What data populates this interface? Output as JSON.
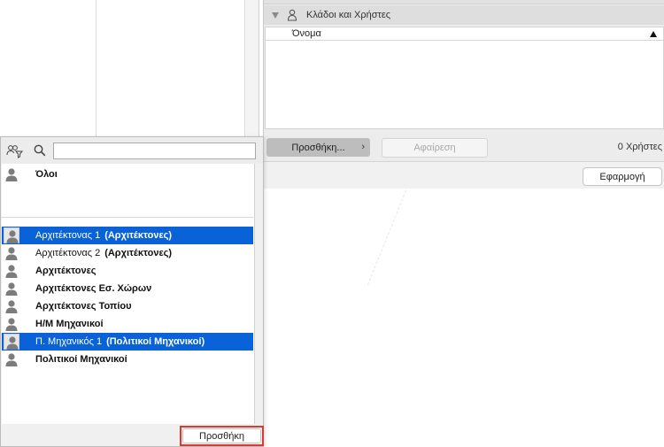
{
  "group_panel": {
    "header_label": "Κλάδοι και Χρήστες",
    "column_name": "Όνομα",
    "add_button": "Προσθήκη...",
    "remove_button": "Αφαίρεση",
    "user_count": "0 Χρήστες",
    "apply_button": "Εφαρμογή"
  },
  "popover": {
    "search_value": "",
    "all_item": "Όλοι",
    "items": [
      {
        "name": "Αρχιτέκτονας 1",
        "group": "(Αρχιτέκτονες)",
        "selected": true
      },
      {
        "name": "Αρχιτέκτονας 2",
        "group": "(Αρχιτέκτονες)",
        "selected": false
      },
      {
        "name": "Αρχιτέκτονες",
        "group": "",
        "selected": false
      },
      {
        "name": "Αρχιτέκτονες Εσ. Χώρων",
        "group": "",
        "selected": false
      },
      {
        "name": "Αρχιτέκτονες Τοπίου",
        "group": "",
        "selected": false
      },
      {
        "name": "Η/Μ Μηχανικοί",
        "group": "",
        "selected": false
      },
      {
        "name": "Π. Μηχανικός 1",
        "group": "(Πολιτικοί Μηχανικοί)",
        "selected": true
      },
      {
        "name": "Πολιτικοί Μηχανικοί",
        "group": "",
        "selected": false
      }
    ],
    "add_button": "Προσθήκη"
  },
  "colors": {
    "selection": "#0a62d9",
    "highlight_border": "#e0392b"
  },
  "icons": {
    "filter": "people-filter-icon",
    "search": "search-icon",
    "user": "user-avatar-icon",
    "group": "group-icon"
  }
}
